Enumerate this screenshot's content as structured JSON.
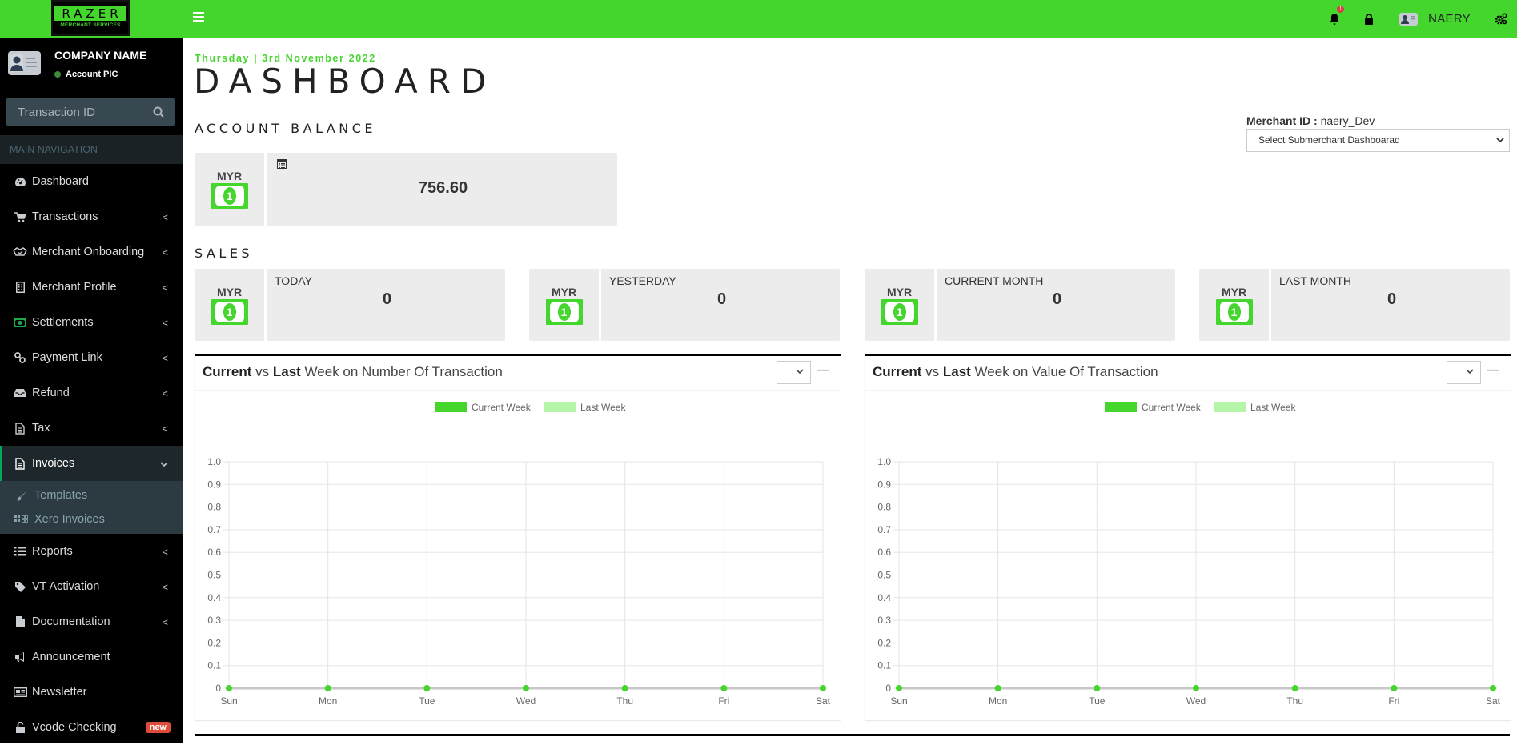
{
  "header": {
    "logo_word": "RAZER",
    "logo_sub": "MERCHANT SERVICES",
    "notification_count": "!",
    "user_name": "NAERY",
    "colors": {
      "brand": "#44d62c",
      "alert": "#e0394a"
    }
  },
  "sidebar": {
    "company_name": "COMPANY NAME",
    "account_label": "Account PIC",
    "search_placeholder": "Transaction ID",
    "section_label": "MAIN NAVIGATION",
    "items": [
      {
        "label": "Dashboard",
        "icon": "dashboard-icon",
        "chevron": ""
      },
      {
        "label": "Transactions",
        "icon": "cart-icon",
        "chevron": "<"
      },
      {
        "label": "Merchant Onboarding",
        "icon": "handshake-icon",
        "chevron": "<"
      },
      {
        "label": "Merchant Profile",
        "icon": "building-icon",
        "chevron": "<"
      },
      {
        "label": "Settlements",
        "icon": "money-icon",
        "chevron": "<"
      },
      {
        "label": "Payment Link",
        "icon": "link-icon",
        "chevron": "<"
      },
      {
        "label": "Refund",
        "icon": "inbox-icon",
        "chevron": "<"
      },
      {
        "label": "Tax",
        "icon": "file-text-icon",
        "chevron": "<"
      },
      {
        "label": "Invoices",
        "icon": "file-text-icon",
        "chevron": "v"
      },
      {
        "label": "Reports",
        "icon": "list-icon",
        "chevron": "<"
      },
      {
        "label": "VT Activation",
        "icon": "tag-icon",
        "chevron": "<"
      },
      {
        "label": "Documentation",
        "icon": "file-icon",
        "chevron": "<"
      },
      {
        "label": "Announcement",
        "icon": "bullhorn-icon",
        "chevron": ""
      },
      {
        "label": "Newsletter",
        "icon": "newspaper-icon",
        "chevron": ""
      },
      {
        "label": "Vcode Checking",
        "icon": "unlock-icon",
        "badge": "new"
      }
    ],
    "invoices_sub": [
      {
        "label": "Templates",
        "icon": "paint-brush-icon"
      },
      {
        "label": "Xero Invoices",
        "icon": "grid-icon"
      }
    ]
  },
  "main": {
    "date": "Thursday | 3rd November 2022",
    "title": "DASHBOARD",
    "account_balance_heading": "ACCOUNT BALANCE",
    "merchant_id_label": "Merchant ID :",
    "merchant_id_value": "naery_Dev",
    "submerchant_select": "Select Submerchant Dashboarad",
    "balance": {
      "currency": "MYR",
      "value": "756.60"
    },
    "sales_heading": "SALES",
    "sales": [
      {
        "currency": "MYR",
        "label": "TODAY",
        "value": "0"
      },
      {
        "currency": "MYR",
        "label": "YESTERDAY",
        "value": "0"
      },
      {
        "currency": "MYR",
        "label": "CURRENT MONTH",
        "value": "0"
      },
      {
        "currency": "MYR",
        "label": "LAST MONTH",
        "value": "0"
      }
    ],
    "panels": [
      {
        "title_a": "Current",
        "title_b": " vs ",
        "title_c": "Last",
        "title_d": " Week on Number Of Transaction"
      },
      {
        "title_a": "Current",
        "title_b": " vs ",
        "title_c": "Last",
        "title_d": " Week on Value Of Transaction"
      }
    ]
  },
  "chart_data": [
    {
      "type": "line",
      "title": "Current vs Last Week on Number Of Transaction",
      "categories": [
        "Sun",
        "Mon",
        "Tue",
        "Wed",
        "Thu",
        "Fri",
        "Sat"
      ],
      "series": [
        {
          "name": "Current Week",
          "color": "#44d62c",
          "values": [
            0,
            0,
            0,
            0,
            0,
            0,
            0
          ]
        },
        {
          "name": "Last Week",
          "color": "#b4f5a8",
          "values": [
            0,
            0,
            0,
            0,
            0,
            0,
            0
          ]
        }
      ],
      "yticks": [
        "0",
        "0.1",
        "0.2",
        "0.3",
        "0.4",
        "0.5",
        "0.6",
        "0.7",
        "0.8",
        "0.9",
        "1.0"
      ],
      "ylim": [
        0,
        1
      ],
      "legend": "top-center",
      "grid": true,
      "xlabel": "",
      "ylabel": ""
    },
    {
      "type": "line",
      "title": "Current vs Last Week on Value Of Transaction",
      "categories": [
        "Sun",
        "Mon",
        "Tue",
        "Wed",
        "Thu",
        "Fri",
        "Sat"
      ],
      "series": [
        {
          "name": "Current Week",
          "color": "#44d62c",
          "values": [
            0,
            0,
            0,
            0,
            0,
            0,
            0
          ]
        },
        {
          "name": "Last Week",
          "color": "#b4f5a8",
          "values": [
            0,
            0,
            0,
            0,
            0,
            0,
            0
          ]
        }
      ],
      "yticks": [
        "0",
        "0.1",
        "0.2",
        "0.3",
        "0.4",
        "0.5",
        "0.6",
        "0.7",
        "0.8",
        "0.9",
        "1.0"
      ],
      "ylim": [
        0,
        1
      ],
      "legend": "top-center",
      "grid": true,
      "xlabel": "",
      "ylabel": ""
    }
  ]
}
